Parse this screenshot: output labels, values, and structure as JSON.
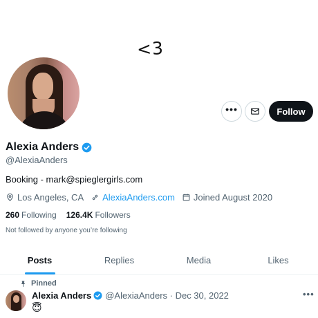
{
  "banner": {
    "text": "<3"
  },
  "actions": {
    "follow_label": "Follow",
    "more_label": "•••"
  },
  "profile": {
    "name": "Alexia Anders",
    "handle": "@AlexiaAnders",
    "bio": "Booking - mark@spieglergirls.com",
    "location": "Los Angeles, CA",
    "website": "AlexiaAnders.com",
    "joined": "Joined August 2020",
    "following_count": "260",
    "following_label": "Following",
    "followers_count": "126.4K",
    "followers_label": "Followers",
    "not_followed_text": "Not followed by anyone you’re following"
  },
  "tabs": [
    {
      "label": "Posts",
      "active": true
    },
    {
      "label": "Replies",
      "active": false
    },
    {
      "label": "Media",
      "active": false
    },
    {
      "label": "Likes",
      "active": false
    }
  ],
  "pinned_post": {
    "pinned_label": "Pinned",
    "author_name": "Alexia Anders",
    "author_handle_date": "@AlexiaAnders · Dec 30, 2022",
    "more_label": "•••",
    "content": "😇"
  },
  "colors": {
    "accent": "#1d9bf0",
    "text": "#0f1419",
    "muted": "#536471",
    "follow_bg": "#0f1419"
  },
  "icons": [
    "more-icon",
    "mail-icon",
    "verified-badge-icon",
    "location-pin-icon",
    "link-icon",
    "calendar-icon",
    "pin-icon"
  ]
}
